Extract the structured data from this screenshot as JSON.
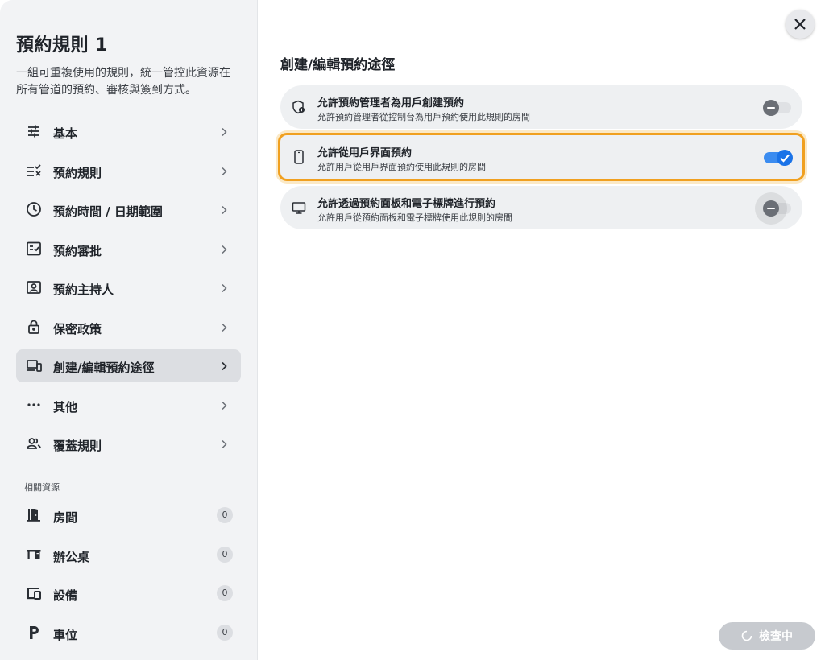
{
  "sidebar": {
    "title": "預約規則 1",
    "description": "一組可重複使用的規則，統一管控此資源在所有管道的預約、審核與簽到方式。",
    "nav": [
      {
        "label": "基本",
        "icon": "sliders-icon"
      },
      {
        "label": "預約規則",
        "icon": "checklist-icon"
      },
      {
        "label": "預約時間 / 日期範圍",
        "icon": "clock-icon"
      },
      {
        "label": "預約審批",
        "icon": "approval-icon"
      },
      {
        "label": "預約主持人",
        "icon": "host-icon"
      },
      {
        "label": "保密政策",
        "icon": "lock-icon"
      },
      {
        "label": "創建/編輯預約途徑",
        "icon": "devices-icon",
        "active": true
      },
      {
        "label": "其他",
        "icon": "more-icon"
      },
      {
        "label": "覆蓋規則",
        "icon": "people-icon"
      }
    ],
    "resources_label": "相關資源",
    "resources": [
      {
        "label": "房間",
        "count": "0",
        "icon": "door-icon"
      },
      {
        "label": "辦公桌",
        "count": "0",
        "icon": "desk-icon"
      },
      {
        "label": "設備",
        "count": "0",
        "icon": "device-icon"
      },
      {
        "label": "車位",
        "count": "0",
        "icon": "parking-icon"
      }
    ]
  },
  "main": {
    "title": "創建/編輯預約途徑",
    "options": [
      {
        "title": "允許預約管理者為用戶創建預約",
        "subtitle": "允許預約管理者從控制台為用戶預約使用此規則的房間",
        "icon": "admin-shield-icon",
        "enabled": false
      },
      {
        "title": "允許從用戶界面預約",
        "subtitle": "允許用戶從用戶界面預約使用此規則的房間",
        "icon": "phone-icon",
        "enabled": true
      },
      {
        "title": "允許透過預約面板和電子標牌進行預約",
        "subtitle": "允許用戶從預約面板和電子標牌使用此規則的房間",
        "icon": "monitor-icon",
        "enabled": false
      }
    ],
    "check_button": "檢查中"
  },
  "colors": {
    "accent": "#1a73e8",
    "highlight": "#f0a020"
  }
}
